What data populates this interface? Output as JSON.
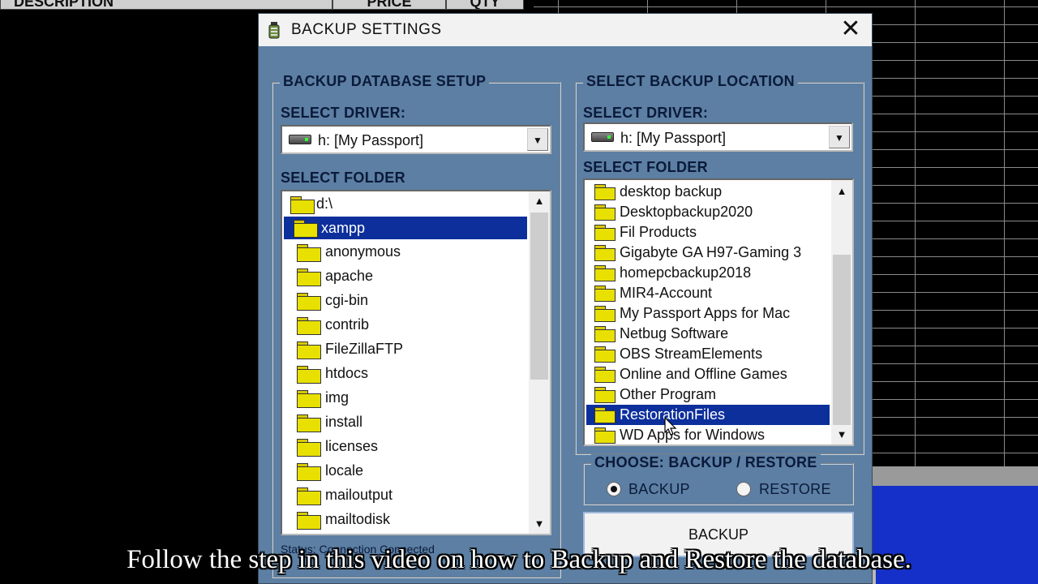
{
  "background": {
    "columns": [
      "DESCRIPTION",
      "PRICE",
      "QTY"
    ]
  },
  "dialog": {
    "title": "BACKUP SETTINGS",
    "close_glyph": "✕",
    "left": {
      "group_title": "BACKUP DATABASE SETUP",
      "driver_label": "SELECT DRIVER:",
      "driver_value": "h: [My Passport]",
      "folder_label": "SELECT FOLDER",
      "tree": [
        {
          "label": "d:\\",
          "selected": false,
          "level": 0
        },
        {
          "label": "xampp",
          "selected": true,
          "level": 1
        },
        {
          "label": "anonymous",
          "selected": false,
          "level": 2
        },
        {
          "label": "apache",
          "selected": false,
          "level": 2
        },
        {
          "label": "cgi-bin",
          "selected": false,
          "level": 2
        },
        {
          "label": "contrib",
          "selected": false,
          "level": 2
        },
        {
          "label": "FileZillaFTP",
          "selected": false,
          "level": 2
        },
        {
          "label": "htdocs",
          "selected": false,
          "level": 2
        },
        {
          "label": "img",
          "selected": false,
          "level": 2
        },
        {
          "label": "install",
          "selected": false,
          "level": 2
        },
        {
          "label": "licenses",
          "selected": false,
          "level": 2
        },
        {
          "label": "locale",
          "selected": false,
          "level": 2
        },
        {
          "label": "mailoutput",
          "selected": false,
          "level": 2
        },
        {
          "label": "mailtodisk",
          "selected": false,
          "level": 2
        }
      ],
      "status": "Status: Connection Connected"
    },
    "right": {
      "group_title": "SELECT BACKUP LOCATION",
      "driver_label": "SELECT DRIVER:",
      "driver_value": "h: [My Passport]",
      "folder_label": "SELECT FOLDER",
      "folders": [
        {
          "label": "desktop backup",
          "selected": false
        },
        {
          "label": "Desktopbackup2020",
          "selected": false
        },
        {
          "label": "Fil Products",
          "selected": false
        },
        {
          "label": "Gigabyte GA H97-Gaming 3",
          "selected": false
        },
        {
          "label": "homepcbackup2018",
          "selected": false
        },
        {
          "label": "MIR4-Account",
          "selected": false
        },
        {
          "label": "My Passport Apps for Mac",
          "selected": false
        },
        {
          "label": "Netbug Software",
          "selected": false
        },
        {
          "label": "OBS StreamElements",
          "selected": false
        },
        {
          "label": "Online and Offline Games",
          "selected": false
        },
        {
          "label": "Other Program",
          "selected": false
        },
        {
          "label": "RestorationFiles",
          "selected": true
        },
        {
          "label": "WD Apps for Windows",
          "selected": false
        }
      ],
      "choose_title": "CHOOSE: BACKUP / RESTORE",
      "option_backup": "BACKUP",
      "option_restore": "RESTORE",
      "selected_option": "BACKUP",
      "action_button": "BACKUP"
    }
  },
  "caption": "Follow the step in this video on how to Backup and Restore the database."
}
